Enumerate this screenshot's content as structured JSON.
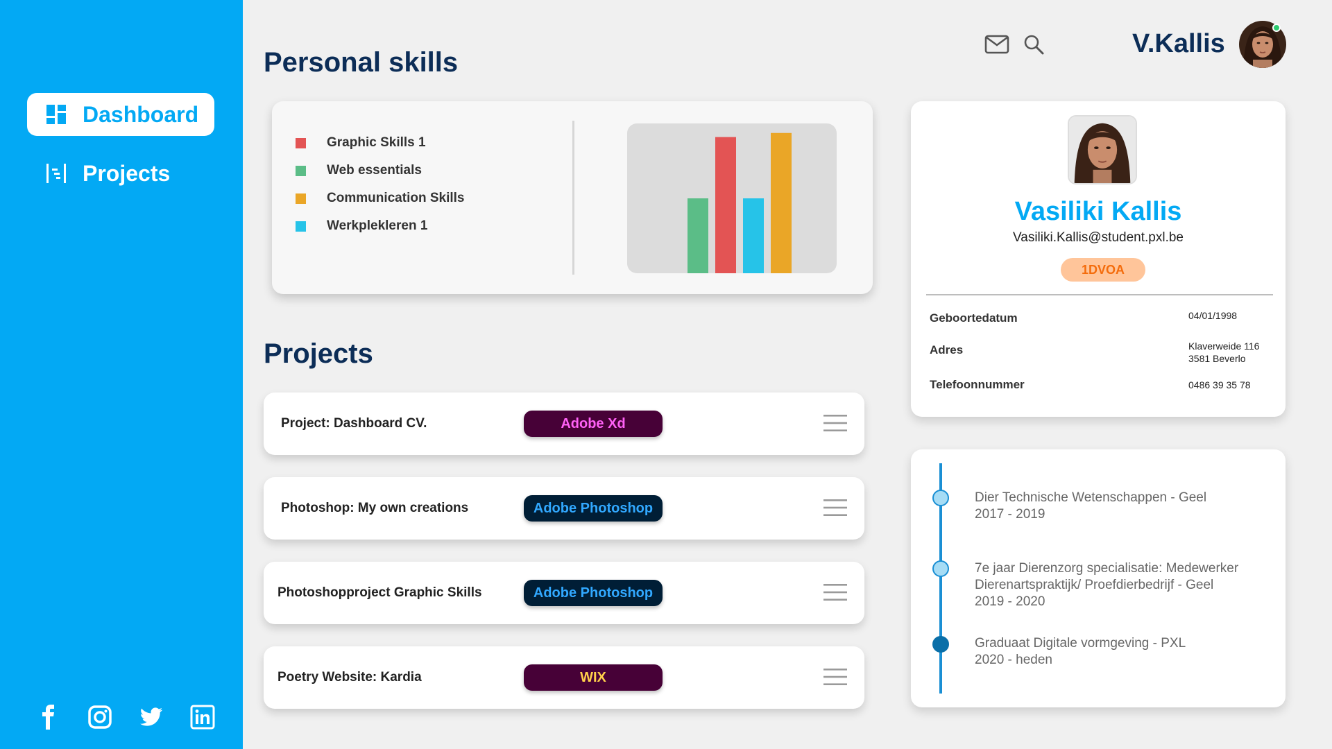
{
  "sidebar": {
    "items": [
      {
        "label": "Dashboard",
        "icon": "dashboard-icon",
        "active": true
      },
      {
        "label": "Projects",
        "icon": "projects-icon",
        "active": false
      }
    ],
    "socials": [
      "facebook-icon",
      "instagram-icon",
      "twitter-icon",
      "linkedin-icon"
    ]
  },
  "header": {
    "user_name": "V.Kallis",
    "icons": [
      "mail-icon",
      "search-icon"
    ]
  },
  "skills": {
    "title": "Personal skills",
    "legend": [
      {
        "label": "Graphic Skills 1",
        "color": "#e35454"
      },
      {
        "label": "Web essentials",
        "color": "#5bbd87"
      },
      {
        "label": "Communication Skills",
        "color": "#eaa627"
      },
      {
        "label": "Werkplekleren 1",
        "color": "#26c3e8"
      }
    ]
  },
  "chart_data": {
    "type": "bar",
    "categories": [
      "Web essentials",
      "Graphic Skills 1",
      "Werkplekleren 1",
      "Communication Skills"
    ],
    "values": [
      55,
      100,
      55,
      103
    ],
    "colors": [
      "#5bbd87",
      "#e35454",
      "#26c3e8",
      "#eaa627"
    ],
    "ylim": [
      0,
      110
    ],
    "grid": false,
    "legend": "left"
  },
  "projects": {
    "title": "Projects",
    "items": [
      {
        "name": "Project: Dashboard CV.",
        "tag": "Adobe Xd",
        "tag_bg": "#470137",
        "tag_color": "#ff61f6"
      },
      {
        "name": "Photoshop: My own creations",
        "tag": "Adobe Photoshop",
        "tag_bg": "#001e36",
        "tag_color": "#31a8ff"
      },
      {
        "name": "Photoshopproject Graphic Skills",
        "tag": "Adobe Photoshop",
        "tag_bg": "#001e36",
        "tag_color": "#31a8ff"
      },
      {
        "name": "Poetry Website: Kardia",
        "tag": "WIX",
        "tag_bg": "#470137",
        "tag_color": "#ffd04a"
      }
    ]
  },
  "profile": {
    "name": "Vasiliki Kallis",
    "email": "Vasiliki.Kallis@student.pxl.be",
    "class": "1DVOA",
    "fields": [
      {
        "label": "Geboortedatum",
        "value": [
          "04/01/1998"
        ]
      },
      {
        "label": "Adres",
        "value": [
          "Klaverweide 116",
          "3581 Beverlo"
        ]
      },
      {
        "label": "Telefoonnummer",
        "value": [
          "0486 39 35 78"
        ]
      }
    ]
  },
  "timeline": [
    {
      "lines": [
        "Dier Technische Wetenschappen - Geel",
        "2017 - 2019"
      ],
      "current": false
    },
    {
      "lines": [
        "7e jaar Dierenzorg specialisatie: Medewerker",
        "Dierenartspraktijk/ Proefdierbedrijf - Geel",
        "2019 - 2020"
      ],
      "current": false
    },
    {
      "lines": [
        "Graduaat Digitale vormgeving - PXL",
        "2020 - heden"
      ],
      "current": true
    }
  ]
}
